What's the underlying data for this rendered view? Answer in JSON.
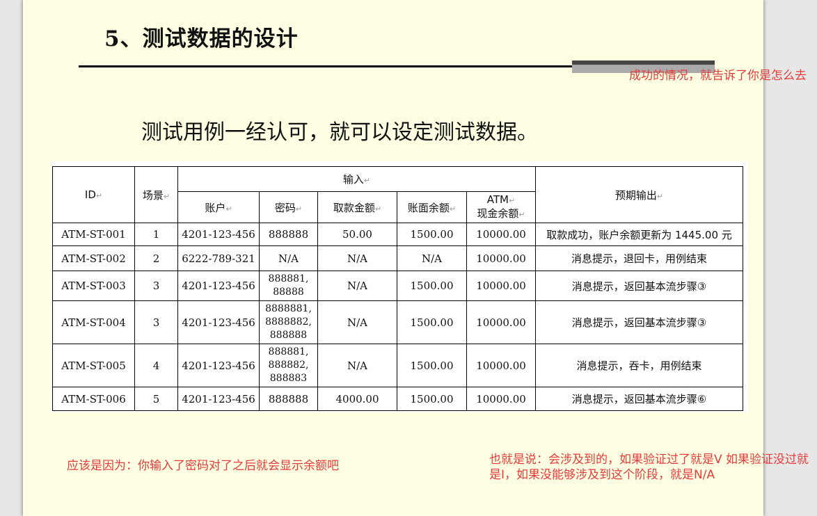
{
  "title": "5、测试数据的设计",
  "subtitle": "测试用例一经认可，就可以设定测试数据。",
  "annotations": {
    "note_success": "成功的情况，就告诉了你是怎么去",
    "note_password": "应该是因为：你输入了密码对了之后就会显示余额吧",
    "note_validation": "也就是说：会涉及到的，如果验证过了就是V 如果验证没过就是I，如果没能够涉及到这个阶段，就是N/A"
  },
  "table": {
    "headers": {
      "id": "ID",
      "scenario": "场景",
      "input": "输入",
      "account": "账户",
      "password": "密码",
      "withdraw": "取款金额",
      "balance": "账面余额",
      "atm_cash_line1": "ATM",
      "atm_cash_line2": "现金余额",
      "expected": "预期输出"
    },
    "rows": [
      {
        "id": "ATM-ST-001",
        "scenario": "1",
        "account": "4201-123-456",
        "password": "888888",
        "withdraw": "50.00",
        "balance": "1500.00",
        "atm_cash": "10000.00",
        "expected": "取款成功，账户余额更新为 1445.00 元"
      },
      {
        "id": "ATM-ST-002",
        "scenario": "2",
        "account": "6222-789-321",
        "password": "N/A",
        "withdraw": "N/A",
        "balance": "N/A",
        "atm_cash": "10000.00",
        "expected": "消息提示，退回卡，用例结束"
      },
      {
        "id": "ATM-ST-003",
        "scenario": "3",
        "account": "4201-123-456",
        "password": "888881, 88888",
        "withdraw": "N/A",
        "balance": "1500.00",
        "atm_cash": "10000.00",
        "expected": "消息提示，返回基本流步骤③"
      },
      {
        "id": "ATM-ST-004",
        "scenario": "3",
        "account": "4201-123-456",
        "password": "8888881, 8888882, 888888",
        "withdraw": "N/A",
        "balance": "1500.00",
        "atm_cash": "10000.00",
        "expected": "消息提示，返回基本流步骤③"
      },
      {
        "id": "ATM-ST-005",
        "scenario": "4",
        "account": "4201-123-456",
        "password": "888881, 888882, 888883",
        "withdraw": "N/A",
        "balance": "1500.00",
        "atm_cash": "10000.00",
        "expected": "消息提示，吞卡，用例结束"
      },
      {
        "id": "ATM-ST-006",
        "scenario": "5",
        "account": "4201-123-456",
        "password": "888888",
        "withdraw": "4000.00",
        "balance": "1500.00",
        "atm_cash": "10000.00",
        "expected": "消息提示，返回基本流步骤⑥"
      }
    ]
  }
}
